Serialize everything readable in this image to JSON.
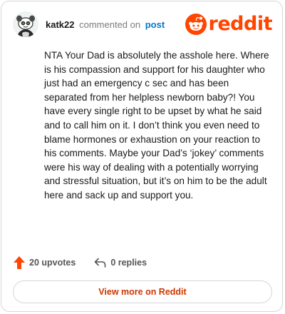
{
  "comment": {
    "username": "katk22",
    "action_text": "commented on",
    "post_link_text": "post",
    "body": "NTA Your Dad is absolutely the asshole here. Where is his compassion and support for his daughter who just had an emergency c sec and has been separated from her helpless newborn baby?! You have every single right to be upset by what he said and to call him on it. I don’t think you even need to blame hormones or exhaustion on your reaction to his comments. Maybe your Dad’s ‘jokey’ comments were his way of dealing with a potentially worrying and stressful situation, but it’s on him to be the adult here and sack up and support you.",
    "upvotes_label": "20 upvotes",
    "replies_label": "0 replies"
  },
  "brand": {
    "logo_text": "reddit",
    "accent_color": "#ff4500",
    "icon": "reddit-alien-icon"
  },
  "footer": {
    "view_more_label": "View more on Reddit"
  }
}
